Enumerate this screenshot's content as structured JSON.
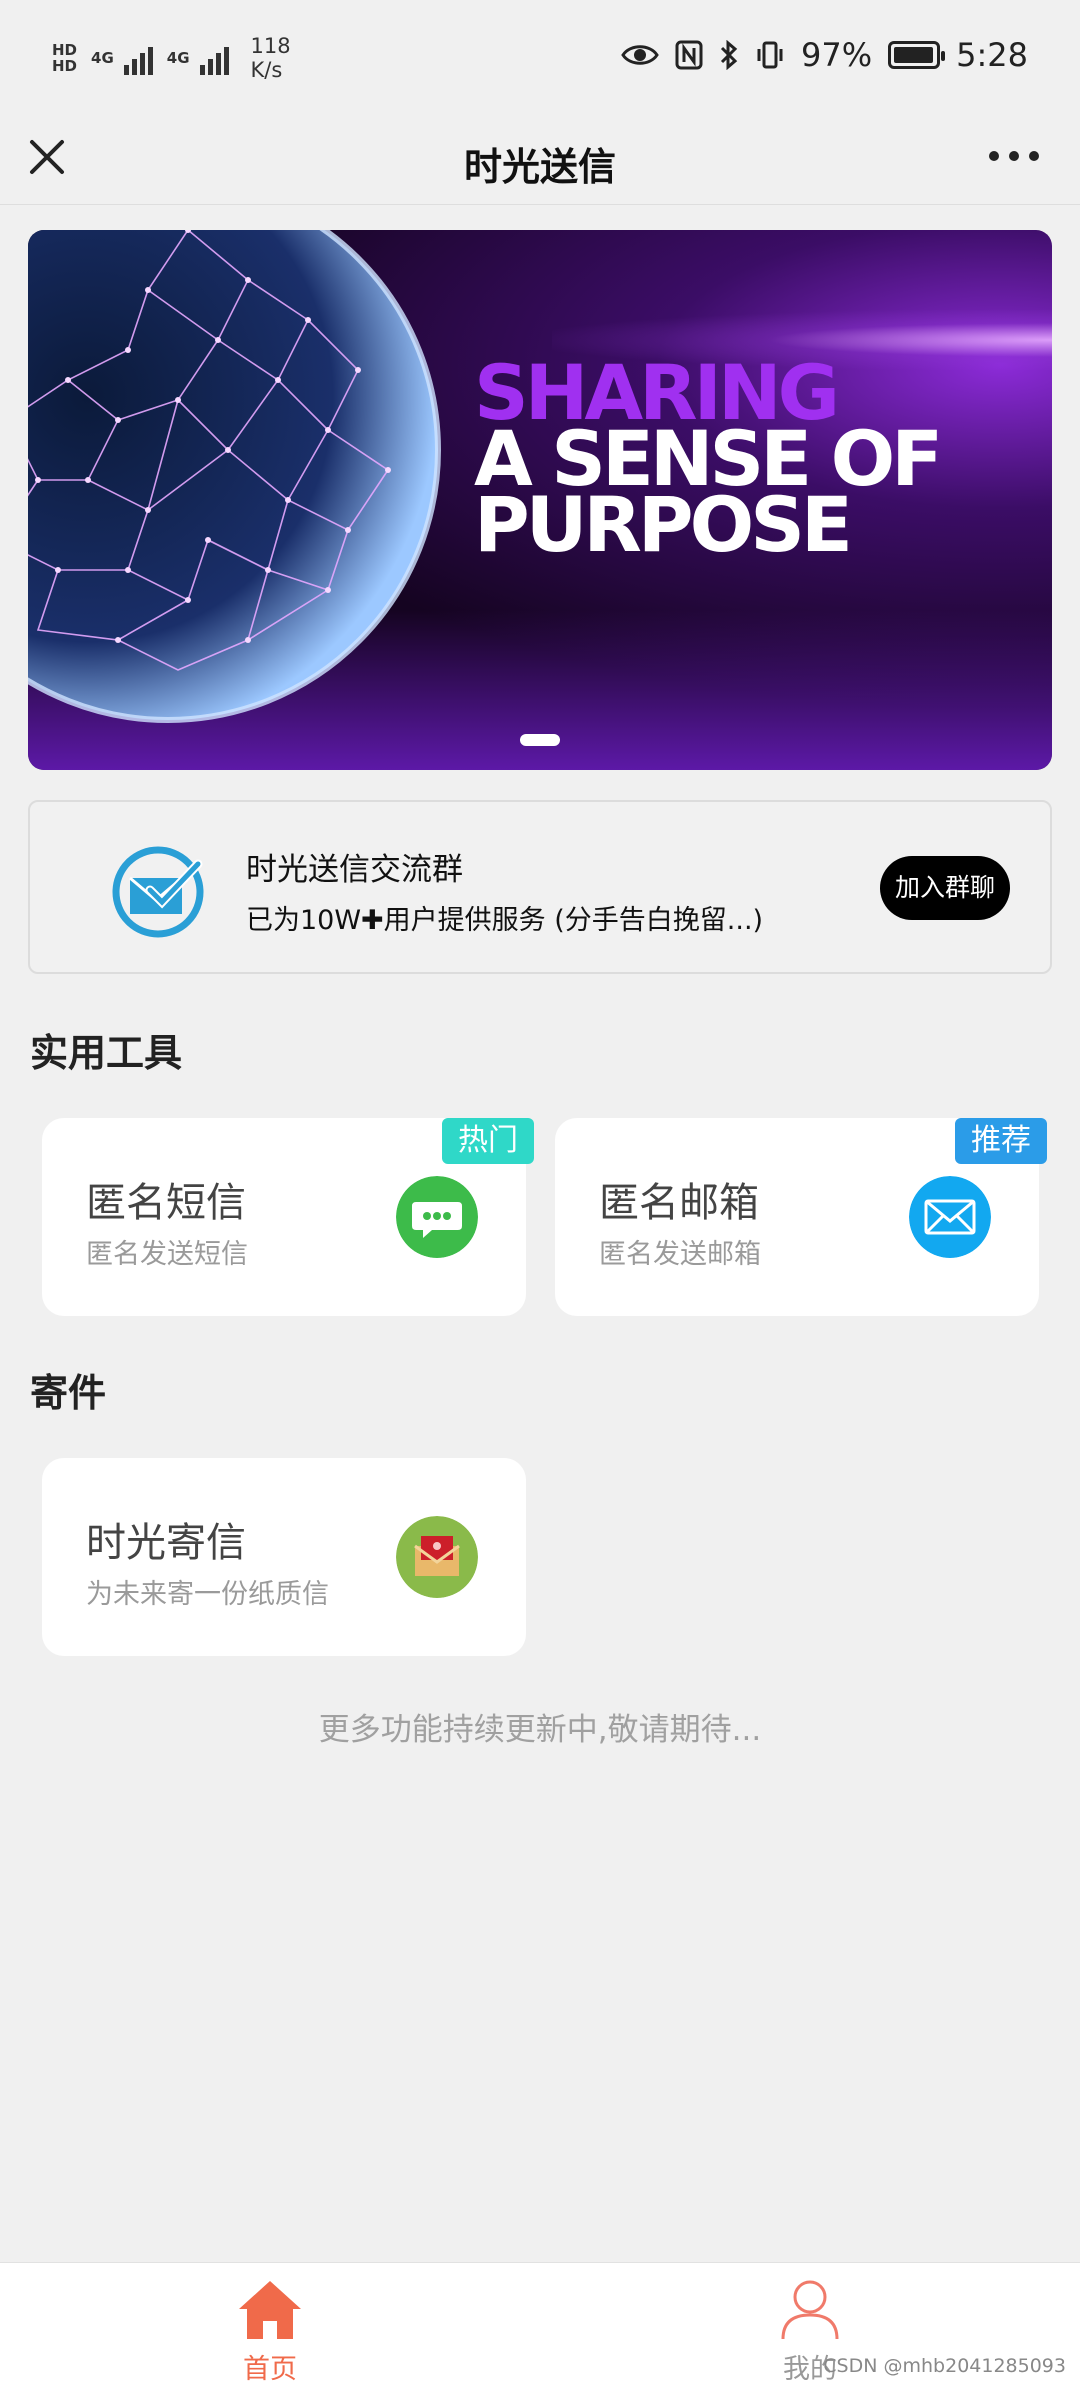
{
  "status_bar": {
    "hd_top": "HD",
    "hd_bottom": "HD",
    "net1": "4G",
    "net2": "4G",
    "speed_value": "118",
    "speed_unit": "K/s",
    "battery_level": "97%",
    "battery_fraction": 0.97,
    "time": "5:28",
    "icons": [
      "eye-icon",
      "nfc-icon",
      "bluetooth-icon",
      "vibrate-icon",
      "battery-icon"
    ]
  },
  "nav": {
    "title": "时光送信",
    "left_icon": "close-icon",
    "right_icon": "more-icon"
  },
  "banner": {
    "line1": "SHARING",
    "line2": "A SENSE OF",
    "line3": "PURPOSE",
    "accent": "#a030f0"
  },
  "group": {
    "title": "时光送信交流群",
    "subtitle": "已为10W✚用户提供服务 (分手告白挽留...)",
    "join_label": "加入群聊"
  },
  "sections": {
    "tools_title": "实用工具",
    "mail_title": "寄件"
  },
  "tools": [
    {
      "name": "匿名短信",
      "desc": "匿名发送短信",
      "badge": "热门",
      "badge_color": "#2fd8c8",
      "icon": "chat-bubble-icon",
      "icon_color": "#3dbb4a"
    },
    {
      "name": "匿名邮箱",
      "desc": "匿名发送邮箱",
      "badge": "推荐",
      "badge_color": "#2b9ce8",
      "icon": "envelope-icon",
      "icon_color": "#12a8f0"
    }
  ],
  "mail": [
    {
      "name": "时光寄信",
      "desc": "为未来寄一份纸质信",
      "icon": "letter-icon",
      "icon_color": "#8aba4a"
    }
  ],
  "footer_note": "更多功能持续更新中,敬请期待...",
  "tabs": [
    {
      "label": "首页",
      "icon": "home-icon",
      "active": true,
      "color": "#f06a4a"
    },
    {
      "label": "我的",
      "icon": "user-icon",
      "active": false,
      "color": "#999999"
    }
  ],
  "watermark": "CSDN @mhb2041285093"
}
